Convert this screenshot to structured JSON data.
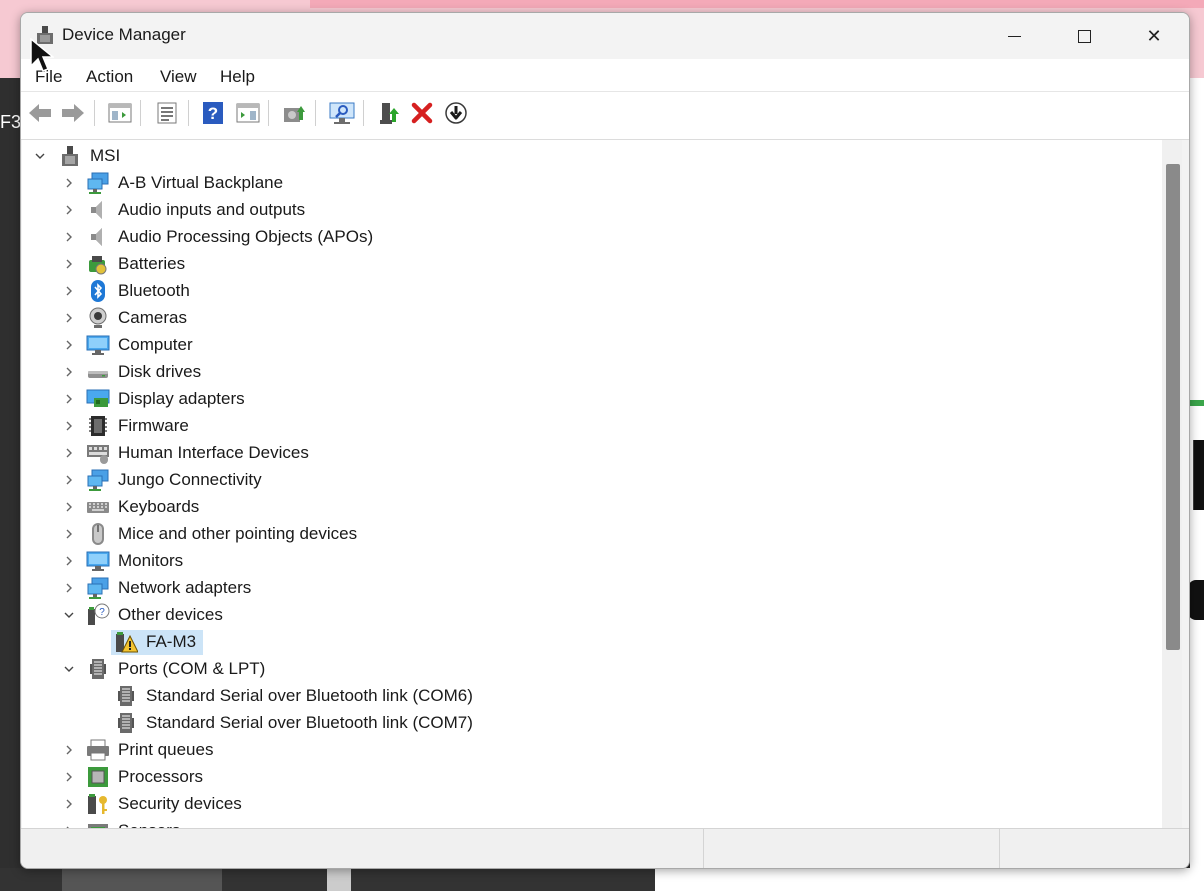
{
  "window": {
    "title": "Device Manager",
    "close_glyph": "✕"
  },
  "menu": [
    "File",
    "Action",
    "View",
    "Help"
  ],
  "toolbar": [
    {
      "name": "back-arrow-icon"
    },
    {
      "name": "forward-arrow-icon"
    },
    {
      "name": "show-hide-console-tree-icon"
    },
    {
      "name": "properties-icon"
    },
    {
      "name": "help-icon"
    },
    {
      "name": "show-action-pane-icon"
    },
    {
      "name": "update-driver-icon"
    },
    {
      "name": "scan-hardware-changes-icon"
    },
    {
      "name": "enable-device-icon"
    },
    {
      "name": "uninstall-device-icon"
    },
    {
      "name": "disable-device-icon"
    }
  ],
  "tree": {
    "root": "MSI",
    "items": [
      {
        "label": "A-B Virtual Backplane",
        "icon": "network-icon",
        "expanded": false
      },
      {
        "label": "Audio inputs and outputs",
        "icon": "speaker-icon",
        "expanded": false
      },
      {
        "label": "Audio Processing Objects (APOs)",
        "icon": "speaker-icon",
        "expanded": false
      },
      {
        "label": "Batteries",
        "icon": "battery-icon",
        "expanded": false
      },
      {
        "label": "Bluetooth",
        "icon": "bluetooth-icon",
        "expanded": false
      },
      {
        "label": "Cameras",
        "icon": "camera-icon",
        "expanded": false
      },
      {
        "label": "Computer",
        "icon": "monitor-icon",
        "expanded": false
      },
      {
        "label": "Disk drives",
        "icon": "disk-icon",
        "expanded": false
      },
      {
        "label": "Display adapters",
        "icon": "display-adapter-icon",
        "expanded": false
      },
      {
        "label": "Firmware",
        "icon": "chip-icon",
        "expanded": false
      },
      {
        "label": "Human Interface Devices",
        "icon": "hid-icon",
        "expanded": false
      },
      {
        "label": "Jungo Connectivity",
        "icon": "network-icon",
        "expanded": false
      },
      {
        "label": "Keyboards",
        "icon": "keyboard-icon",
        "expanded": false
      },
      {
        "label": "Mice and other pointing devices",
        "icon": "mouse-icon",
        "expanded": false
      },
      {
        "label": "Monitors",
        "icon": "monitor-icon",
        "expanded": false
      },
      {
        "label": "Network adapters",
        "icon": "network-icon",
        "expanded": false
      },
      {
        "label": "Other devices",
        "icon": "unknown-device-icon",
        "expanded": true,
        "children": [
          {
            "label": "FA-M3",
            "icon": "warning-device-icon",
            "selected": true
          }
        ]
      },
      {
        "label": "Ports (COM & LPT)",
        "icon": "port-icon",
        "expanded": true,
        "children": [
          {
            "label": "Standard Serial over Bluetooth link (COM6)",
            "icon": "port-icon"
          },
          {
            "label": "Standard Serial over Bluetooth link (COM7)",
            "icon": "port-icon"
          }
        ]
      },
      {
        "label": "Print queues",
        "icon": "printer-icon",
        "expanded": false
      },
      {
        "label": "Processors",
        "icon": "processor-icon",
        "expanded": false
      },
      {
        "label": "Security devices",
        "icon": "security-icon",
        "expanded": false
      },
      {
        "label": "Sensors",
        "icon": "sensor-icon",
        "expanded": false
      }
    ]
  },
  "background": {
    "left_text": "F3"
  },
  "colors": {
    "selection": "#cce4f7",
    "accent_blue": "#2a7fd4",
    "uninstall_red": "#d62020"
  }
}
